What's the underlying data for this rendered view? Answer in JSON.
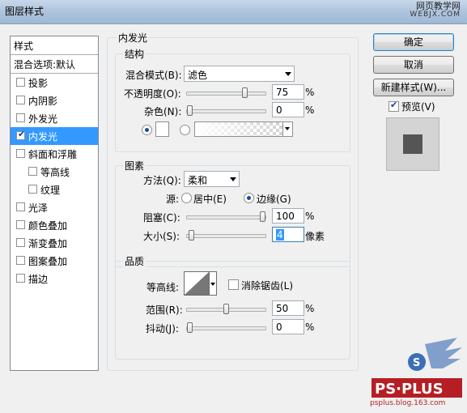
{
  "window": {
    "title": "图层样式"
  },
  "watermark": {
    "site": "网页教学网",
    "url": "WEBJX.COM",
    "bottom": "psplus.blog.163.com"
  },
  "sidebar": {
    "header": "样式",
    "blend": "混合选项:默认",
    "items": [
      {
        "label": "投影",
        "checked": false
      },
      {
        "label": "内阴影",
        "checked": false
      },
      {
        "label": "外发光",
        "checked": false
      },
      {
        "label": "内发光",
        "checked": true,
        "selected": true
      },
      {
        "label": "斜面和浮雕",
        "checked": false
      },
      {
        "label": "等高线",
        "checked": false,
        "indent": true
      },
      {
        "label": "纹理",
        "checked": false,
        "indent": true
      },
      {
        "label": "光泽",
        "checked": false
      },
      {
        "label": "颜色叠加",
        "checked": false
      },
      {
        "label": "渐变叠加",
        "checked": false
      },
      {
        "label": "图案叠加",
        "checked": false
      },
      {
        "label": "描边",
        "checked": false
      }
    ]
  },
  "panel": {
    "title": "内发光",
    "structure": {
      "title": "结构",
      "blend_mode_label": "混合模式(B):",
      "blend_mode_value": "滤色",
      "opacity_label": "不透明度(O):",
      "opacity_value": "75",
      "opacity_unit": "%",
      "opacity_level": 0.75,
      "noise_label": "杂色(N):",
      "noise_value": "0",
      "noise_unit": "%",
      "noise_level": 0
    },
    "elements": {
      "title": "图素",
      "method_label": "方法(Q):",
      "method_value": "柔和",
      "source_label": "源:",
      "source_center": "居中(E)",
      "source_edge": "边缘(G)",
      "choke_label": "阻塞(C):",
      "choke_value": "100",
      "choke_unit": "%",
      "choke_level": 1.0,
      "size_label": "大小(S):",
      "size_value": "4",
      "size_unit": "像素",
      "size_level": 0.02
    },
    "quality": {
      "title": "品质",
      "contour_label": "等高线:",
      "antialias_label": "消除锯齿(L)",
      "range_label": "范围(R):",
      "range_value": "50",
      "range_unit": "%",
      "range_level": 0.5,
      "jitter_label": "抖动(J):",
      "jitter_value": "0",
      "jitter_unit": "%",
      "jitter_level": 0
    }
  },
  "buttons": {
    "ok": "确定",
    "cancel": "取消",
    "new_style": "新建样式(W)...",
    "preview_label": "预览(V)",
    "preview_checked": true
  },
  "colors": {
    "selection": "#3399ff",
    "preview_square": "#555555"
  }
}
